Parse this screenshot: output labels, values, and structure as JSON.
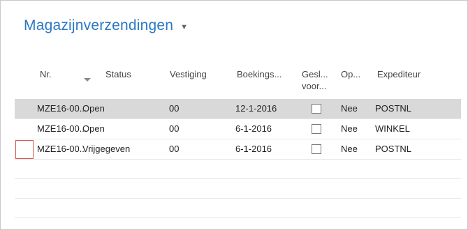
{
  "page": {
    "title": "Magazijnverzendingen"
  },
  "table": {
    "columns": [
      "Nr.",
      "Status",
      "Vestiging",
      "Boekings...",
      "Gesl... voor...",
      "Op...",
      "Expediteur"
    ],
    "column_lines": [
      [
        "Nr."
      ],
      [
        "Status"
      ],
      [
        "Vestiging"
      ],
      [
        "Boekings..."
      ],
      [
        "Gesl...",
        "voor..."
      ],
      [
        "Op..."
      ],
      [
        "Expediteur"
      ]
    ],
    "rows": [
      {
        "nr": "MZE16-00...",
        "status": "Open",
        "vestiging": "00",
        "boekingsdatum": "12-1-2016",
        "gesloten": false,
        "op": "Nee",
        "expediteur": "POSTNL",
        "selected": true
      },
      {
        "nr": "MZE16-00...",
        "status": "Open",
        "vestiging": "00",
        "boekingsdatum": "6-1-2016",
        "gesloten": false,
        "op": "Nee",
        "expediteur": "WINKEL",
        "selected": false
      },
      {
        "nr": "MZE16-00...",
        "status": "Vrijgegeven",
        "vestiging": "00",
        "boekingsdatum": "6-1-2016",
        "gesloten": false,
        "op": "Nee",
        "expediteur": "POSTNL",
        "selected": false
      }
    ]
  },
  "colors": {
    "title": "#2a78c4",
    "selected_row": "#d9d9d9",
    "focus_border": "#d9534f"
  },
  "icons": {
    "title_dropdown": "caret-down-icon",
    "sort": "sort-descending-icon"
  }
}
